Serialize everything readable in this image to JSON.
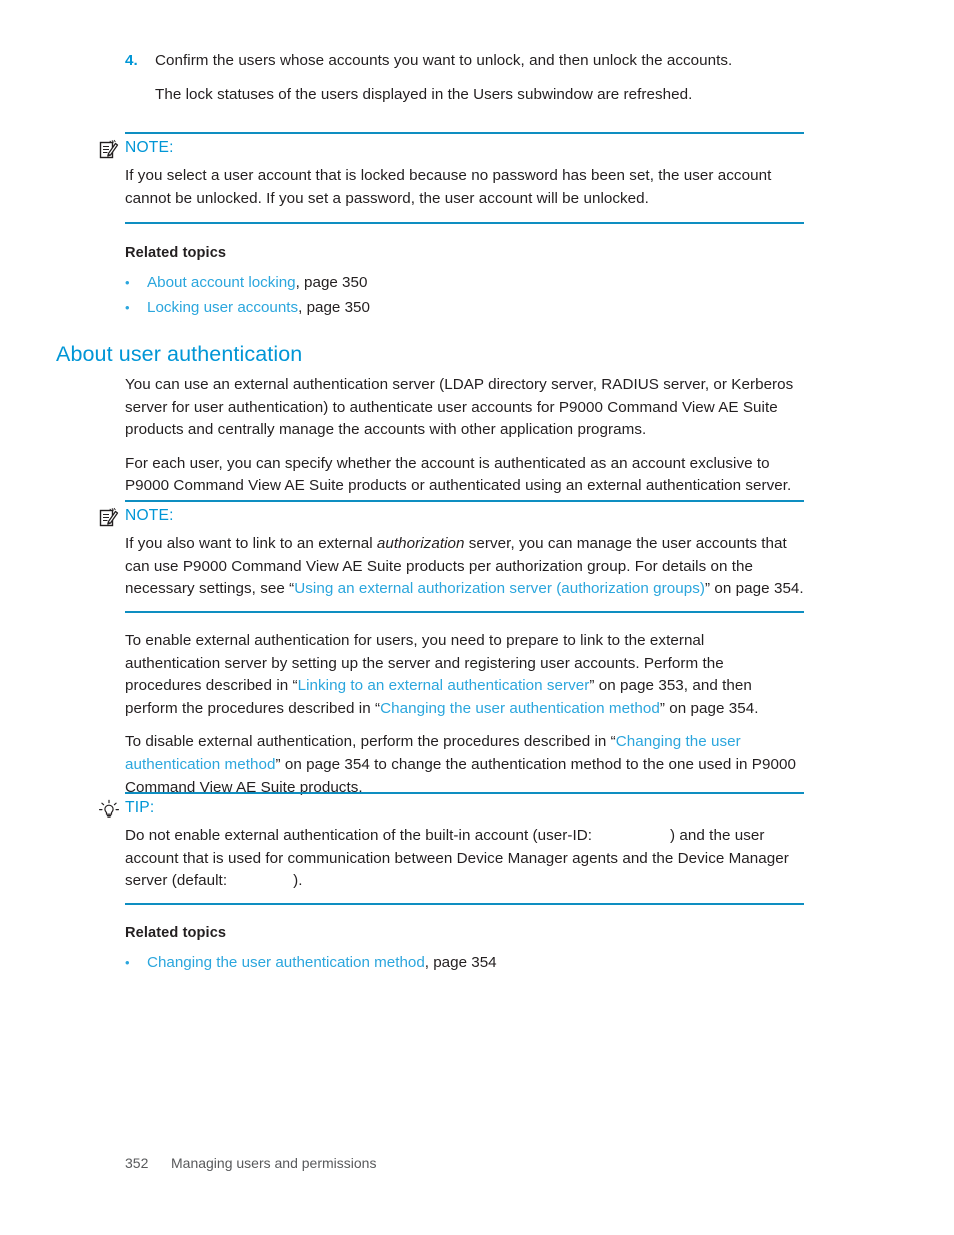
{
  "step": {
    "number": "4.",
    "instruction": "Confirm the users whose accounts you want to unlock, and then unlock the accounts.",
    "result": "The lock statuses of the users displayed in the Users subwindow are refreshed."
  },
  "note_one": {
    "icon": "note-document-pencil-icon",
    "label": "NOTE:",
    "text": "If you select a user account that is locked because no password has been set, the user account cannot be unlocked. If you set a password, the user account will be unlocked."
  },
  "related_topics_one": {
    "title": "Related topics",
    "items": [
      {
        "bullet": "•",
        "link": "About account locking",
        "suffix": ", page 350"
      },
      {
        "bullet": "•",
        "link": "Locking user accounts",
        "suffix": ", page 350"
      }
    ]
  },
  "section": {
    "heading": "About user authentication",
    "paragraph_1": "You can use an external authentication server (LDAP directory server, RADIUS server, or Kerberos server for user authentication) to authenticate user accounts for P9000 Command View AE Suite products and centrally manage the accounts with other application programs.",
    "paragraph_2": "For each user, you can specify whether the account is authenticated as an account exclusive to P9000 Command View AE Suite products or authenticated using an external authentication server."
  },
  "note_two": {
    "icon": "note-document-pencil-icon",
    "label": "NOTE:",
    "text_part_1": "If you also want to link to an external ",
    "text_italic": "authorization",
    "text_part_2": " server, you can manage the user accounts that can use P9000 Command View AE Suite products per authorization group. For details on the necessary settings, see “",
    "link": "Using an external authorization server (authorization groups)",
    "text_part_3": "” on page 354."
  },
  "enable_paragraph": {
    "part_1": "To enable external authentication for users, you need to prepare to link to the external authentication server by setting up the server and registering user accounts. Perform the procedures described in “",
    "link_1": "Linking to an external authentication server",
    "part_2": "” on page 353, and then perform the procedures described in “",
    "link_2": "Changing the user authentication method",
    "part_3": "” on page 354."
  },
  "disable_paragraph": {
    "part_1": "To disable external authentication, perform the procedures described in “",
    "link_1": "Changing the user authentication method",
    "part_2": "” on page 354 to change the authentication method to the one used in P9000 Command View AE Suite products."
  },
  "tip": {
    "icon": "lightbulb-icon",
    "label": "TIP:",
    "part_1": "Do not enable external authentication of the built-in account (user-ID:",
    "redacted_userid": "",
    "part_2": ") and the user account that is used for communication between Device Manager agents and the Device Manager server (default:",
    "redacted_default": "",
    "part_3": ")."
  },
  "related_topics_two": {
    "title": "Related topics",
    "items": [
      {
        "bullet": "•",
        "link": "Changing the user authentication method",
        "suffix": ", page 354"
      }
    ]
  },
  "footer": {
    "page_number": "352",
    "chapter": "Managing users and permissions"
  },
  "colors": {
    "accent_blue": "#0096d6",
    "link_blue": "#2ba6dd",
    "rule_blue": "#0e8ec1",
    "body_text": "#231f20",
    "footer_text": "#58595b"
  }
}
